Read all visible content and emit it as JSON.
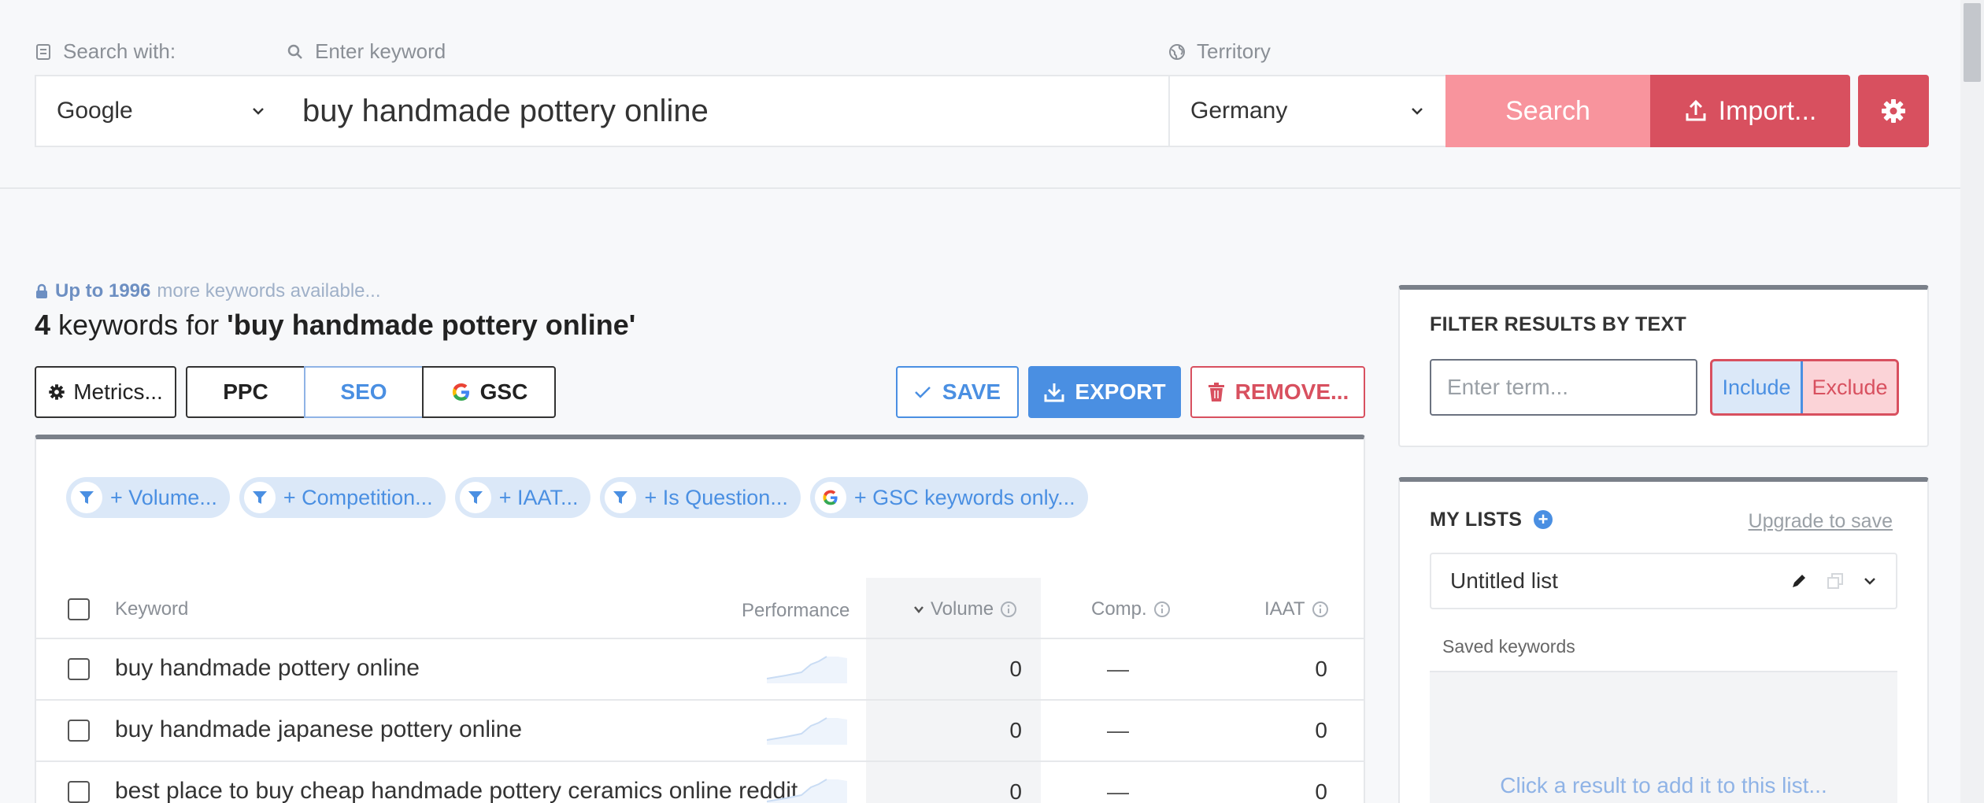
{
  "search": {
    "engine_label": "Search with:",
    "keyword_label": "Enter keyword",
    "territory_label": "Territory",
    "engine_value": "Google",
    "keyword_value": "buy handmade pottery online",
    "territory_value": "Germany",
    "search_button": "Search",
    "import_button": "Import..."
  },
  "results": {
    "more_count": "Up to 1996",
    "more_text": "more keywords available...",
    "count": "4",
    "heading_mid": "keywords for",
    "query": "'buy handmade pottery online'"
  },
  "toolbar": {
    "metrics": "Metrics...",
    "ppc": "PPC",
    "seo": "SEO",
    "gsc": "GSC",
    "save": "SAVE",
    "export": "EXPORT",
    "remove": "REMOVE..."
  },
  "filters": [
    {
      "label": "+ Volume..."
    },
    {
      "label": "+ Competition..."
    },
    {
      "label": "+ IAAT..."
    },
    {
      "label": "+ Is Question..."
    },
    {
      "label": "+ GSC keywords only..."
    }
  ],
  "table": {
    "columns": {
      "keyword": "Keyword",
      "performance": "Performance",
      "volume": "Volume",
      "comp": "Comp.",
      "iaat": "IAAT"
    },
    "rows": [
      {
        "keyword": "buy handmade pottery online",
        "volume": "0",
        "comp": "—",
        "iaat": "0"
      },
      {
        "keyword": "buy handmade japanese pottery online",
        "volume": "0",
        "comp": "—",
        "iaat": "0"
      },
      {
        "keyword": "best place to buy cheap handmade pottery ceramics online reddit",
        "volume": "0",
        "comp": "—",
        "iaat": "0"
      }
    ]
  },
  "filter_panel": {
    "title": "FILTER RESULTS BY TEXT",
    "placeholder": "Enter term...",
    "include": "Include",
    "exclude": "Exclude"
  },
  "lists_panel": {
    "title": "MY LISTS",
    "upgrade": "Upgrade to save",
    "list_name": "Untitled list",
    "saved_label": "Saved keywords",
    "empty_text": "Click a result to add it to this list..."
  },
  "colors": {
    "accent_blue": "#4a8fe2",
    "brand_red": "#d8505f",
    "search_pink": "#f8949d"
  }
}
